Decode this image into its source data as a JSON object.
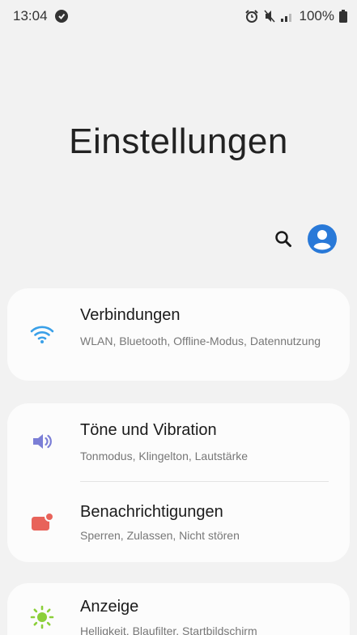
{
  "status_bar": {
    "time": "13:04",
    "battery": "100%"
  },
  "title": "Einstellungen",
  "colors": {
    "accent": "#2979d8",
    "wifi": "#3aa0e8",
    "sound": "#7b7ed6",
    "notification": "#e8635a",
    "display": "#8bcf3a"
  },
  "header_icons": [
    "search-icon",
    "profile-icon"
  ],
  "groups": [
    {
      "items": [
        {
          "icon": "wifi-icon",
          "title": "Verbindungen",
          "subtitle": "WLAN, Bluetooth, Offline-Modus, Datennutzung"
        }
      ]
    },
    {
      "items": [
        {
          "icon": "volume-icon",
          "title": "Töne und Vibration",
          "subtitle": "Tonmodus, Klingelton, Lautstärke"
        },
        {
          "icon": "notification-icon",
          "title": "Benachrichtigungen",
          "subtitle": "Sperren, Zulassen, Nicht stören"
        }
      ]
    },
    {
      "items": [
        {
          "icon": "brightness-icon",
          "title": "Anzeige",
          "subtitle": "Helligkeit, Blaufilter, Startbildschirm"
        }
      ]
    }
  ]
}
